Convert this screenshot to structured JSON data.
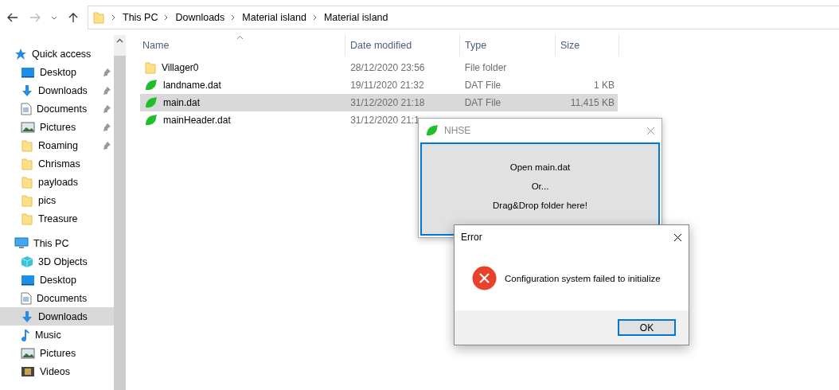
{
  "address_bar": {
    "crumbs": [
      "This PC",
      "Downloads",
      "Material island",
      "Material island"
    ]
  },
  "sidebar": {
    "items": [
      {
        "label": "Quick access",
        "kind": "section",
        "pinned": false,
        "selected": false
      },
      {
        "label": "Desktop",
        "kind": "item",
        "pinned": true,
        "selected": false
      },
      {
        "label": "Downloads",
        "kind": "item",
        "pinned": true,
        "selected": false
      },
      {
        "label": "Documents",
        "kind": "item",
        "pinned": true,
        "selected": false
      },
      {
        "label": "Pictures",
        "kind": "item",
        "pinned": true,
        "selected": false
      },
      {
        "label": "Roaming",
        "kind": "item",
        "pinned": true,
        "selected": false
      },
      {
        "label": "Chrismas",
        "kind": "item",
        "pinned": false,
        "selected": false
      },
      {
        "label": "payloads",
        "kind": "item",
        "pinned": false,
        "selected": false
      },
      {
        "label": "pics",
        "kind": "item",
        "pinned": false,
        "selected": false
      },
      {
        "label": "Treasure",
        "kind": "item",
        "pinned": false,
        "selected": false
      },
      {
        "label": "This PC",
        "kind": "section",
        "pinned": false,
        "selected": false
      },
      {
        "label": "3D Objects",
        "kind": "item",
        "pinned": false,
        "selected": false
      },
      {
        "label": "Desktop",
        "kind": "item",
        "pinned": false,
        "selected": false
      },
      {
        "label": "Documents",
        "kind": "item",
        "pinned": false,
        "selected": false
      },
      {
        "label": "Downloads",
        "kind": "item",
        "pinned": false,
        "selected": true
      },
      {
        "label": "Music",
        "kind": "item",
        "pinned": false,
        "selected": false
      },
      {
        "label": "Pictures",
        "kind": "item",
        "pinned": false,
        "selected": false
      },
      {
        "label": "Videos",
        "kind": "item",
        "pinned": false,
        "selected": false
      }
    ]
  },
  "file_list": {
    "columns": [
      "Name",
      "Date modified",
      "Type",
      "Size"
    ],
    "rows": [
      {
        "name": "Villager0",
        "kind": "folder",
        "date": "28/12/2020 23:56",
        "type": "File folder",
        "selected": false
      },
      {
        "name": "landname.dat",
        "kind": "file",
        "date": "19/11/2020 21:32",
        "type": "DAT File",
        "size": "1 KB",
        "selected": false
      },
      {
        "name": "main.dat",
        "kind": "file",
        "date": "31/12/2020 21:18",
        "type": "DAT File",
        "size": "11,415 KB",
        "selected": true
      },
      {
        "name": "mainHeader.dat",
        "kind": "file",
        "date": "31/12/2020 21:1",
        "selected": false
      }
    ]
  },
  "nhse_window": {
    "title": "NHSE",
    "lines": [
      "Open main.dat",
      "Or...",
      "Drag&Drop folder here!"
    ]
  },
  "error_dialog": {
    "title": "Error",
    "message": "Configuration system failed to initialize",
    "button": "OK"
  }
}
